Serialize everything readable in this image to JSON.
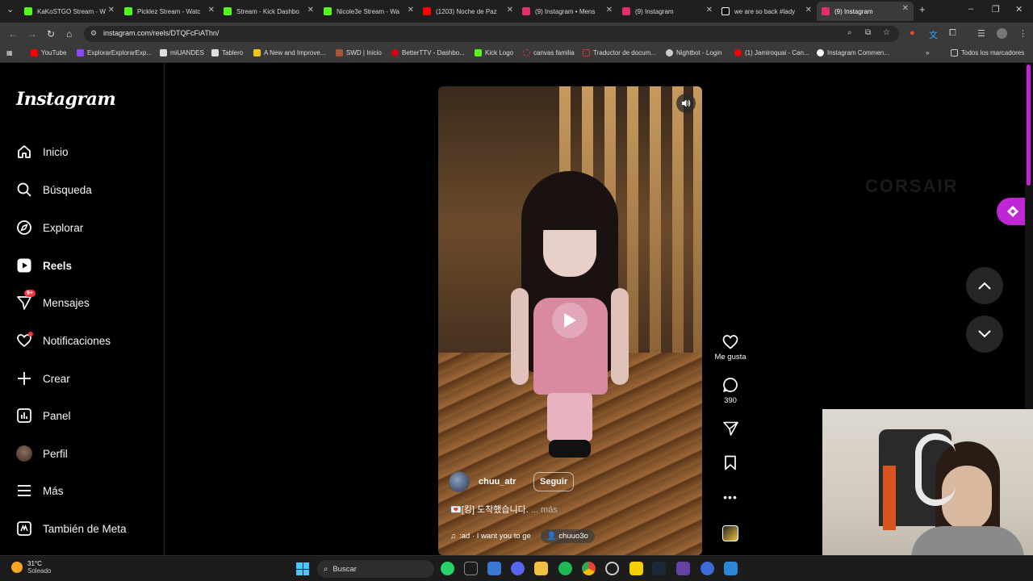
{
  "browser": {
    "tabs": [
      {
        "title": "KaKoSTGO Stream - W",
        "favicon_color": "#53fc18",
        "active": false
      },
      {
        "title": "Picklez Stream - Watc",
        "favicon_color": "#53fc18",
        "active": false
      },
      {
        "title": "Stream - Kick Dashbo",
        "favicon_color": "#53fc18",
        "active": false
      },
      {
        "title": "Nicole3e Stream - Wa",
        "favicon_color": "#53fc18",
        "active": false
      },
      {
        "title": "(1203) Noche de Paz",
        "favicon_color": "#ff0000",
        "active": false
      },
      {
        "title": "(9) Instagram • Mens",
        "favicon_color": "#e1306c",
        "active": false
      },
      {
        "title": "(9) Instagram",
        "favicon_color": "#e1306c",
        "active": false
      },
      {
        "title": "we are so back #lady",
        "favicon_color": "#111111",
        "active": false
      },
      {
        "title": "(9) Instagram",
        "favicon_color": "#e1306c",
        "active": true
      }
    ],
    "url": "instagram.com/reels/DTQFcFiAThn/",
    "bookmarks": [
      {
        "label": "YouTube",
        "color": "#ff0000"
      },
      {
        "label": "ExplorarExplorarExp...",
        "color": "#9146ff"
      },
      {
        "label": "miUANDES",
        "color": "#dddddd"
      },
      {
        "label": "Tablero",
        "color": "#dddddd"
      },
      {
        "label": "A New and Improve...",
        "color": "#f5c518"
      },
      {
        "label": "SWD | Inicio",
        "color": "#aa5533"
      },
      {
        "label": "BetterTTV - Dashbo...",
        "color": "#d50014"
      },
      {
        "label": "Kick Logo",
        "color": "#53fc18"
      },
      {
        "label": "canvas familia",
        "color": "#e13333"
      },
      {
        "label": "Traductor de docum...",
        "color": "#cc3333"
      },
      {
        "label": "Nightbot - Login",
        "color": "#cccccc"
      },
      {
        "label": "(1) Jamiroquai - Can...",
        "color": "#ff0000"
      },
      {
        "label": "Instagram Commen...",
        "color": "#ffffff"
      }
    ],
    "all_bookmarks_label": "Todos los marcadores"
  },
  "sidebar": {
    "logo": "Instagram",
    "items": [
      {
        "label": "Inicio",
        "icon": "home-icon"
      },
      {
        "label": "Búsqueda",
        "icon": "search-icon"
      },
      {
        "label": "Explorar",
        "icon": "compass-icon"
      },
      {
        "label": "Reels",
        "icon": "reels-icon"
      },
      {
        "label": "Mensajes",
        "icon": "messages-icon",
        "badge": "9+"
      },
      {
        "label": "Notificaciones",
        "icon": "heart-icon"
      },
      {
        "label": "Crear",
        "icon": "plus-icon"
      },
      {
        "label": "Panel",
        "icon": "dashboard-icon"
      },
      {
        "label": "Perfil",
        "icon": "avatar-icon"
      },
      {
        "label": "Más",
        "icon": "menu-icon"
      },
      {
        "label": "También de Meta",
        "icon": "meta-icon"
      }
    ]
  },
  "reel": {
    "author": "chuu_atr",
    "follow_label": "Seguir",
    "caption": "💌[킹] 도착했습니다.",
    "caption_more": "... más",
    "audio_text": ":ad · I want you to ge",
    "tagged_user": "chuuo3o"
  },
  "actions": {
    "like_label": "Me gusta",
    "comment_count": "390"
  },
  "watermark": "CORSAIR",
  "taskbar": {
    "temperature": "31°C",
    "weather": "Soleado",
    "search_placeholder": "Buscar"
  }
}
